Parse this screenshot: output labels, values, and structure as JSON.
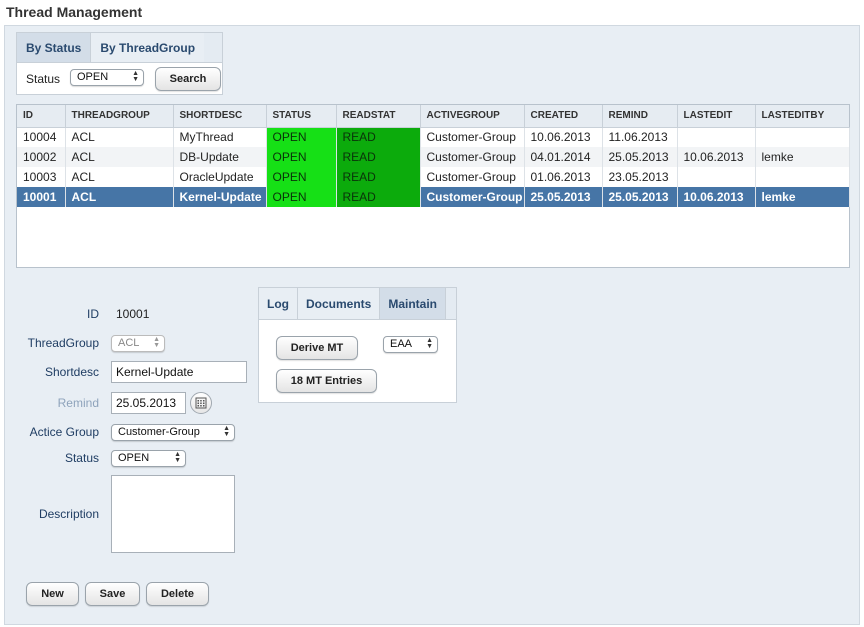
{
  "page_title": "Thread Management",
  "search": {
    "tabs": [
      "By Status",
      "By ThreadGroup"
    ],
    "status_label": "Status",
    "status_value": "OPEN",
    "search_button": "Search"
  },
  "table": {
    "columns": [
      "ID",
      "THREADGROUP",
      "SHORTDESC",
      "STATUS",
      "READSTAT",
      "ACTIVEGROUP",
      "CREATED",
      "REMIND",
      "LASTEDIT",
      "LASTEDITBY"
    ],
    "rows": [
      [
        "10004",
        "ACL",
        "MyThread",
        "OPEN",
        "READ",
        "Customer-Group",
        "10.06.2013",
        "11.06.2013",
        "",
        ""
      ],
      [
        "10002",
        "ACL",
        "DB-Update",
        "OPEN",
        "READ",
        "Customer-Group",
        "04.01.2014",
        "25.05.2013",
        "10.06.2013",
        "lemke"
      ],
      [
        "10003",
        "ACL",
        "OracleUpdate",
        "OPEN",
        "READ",
        "Customer-Group",
        "01.06.2013",
        "23.05.2013",
        "",
        ""
      ],
      [
        "10001",
        "ACL",
        "Kernel-Update",
        "OPEN",
        "READ",
        "Customer-Group",
        "25.05.2013",
        "25.05.2013",
        "10.06.2013",
        "lemke"
      ]
    ],
    "selected_row": 3
  },
  "form": {
    "id_label": "ID",
    "id_value": "10001",
    "threadgroup_label": "ThreadGroup",
    "threadgroup_value": "ACL",
    "shortdesc_label": "Shortdesc",
    "shortdesc_value": "Kernel-Update",
    "remind_label": "Remind",
    "remind_value": "25.05.2013",
    "activegroup_label": "Actice Group",
    "activegroup_value": "Customer-Group",
    "status_label": "Status",
    "status_value": "OPEN",
    "description_label": "Description",
    "description_value": "",
    "buttons": {
      "new": "New",
      "save": "Save",
      "delete": "Delete"
    }
  },
  "detail": {
    "tabs": [
      "Log",
      "Documents",
      "Maintain"
    ],
    "active_tab": "Maintain",
    "derive_button": "Derive MT",
    "entries_button": "18 MT Entries",
    "select_value": "EAA"
  },
  "colors": {
    "accent": "#4675a6",
    "status_open": "#16e016",
    "status_read": "#0cab0c",
    "label_text": "#1f3d63"
  },
  "icons": [
    "calendar-icon",
    "select-arrows-icon"
  ]
}
